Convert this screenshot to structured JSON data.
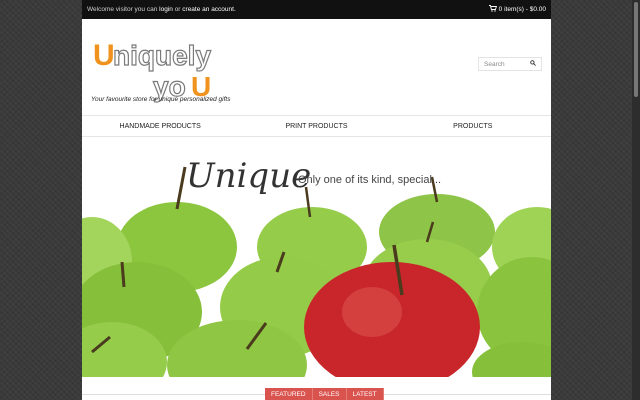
{
  "topbar": {
    "welcome_prefix": "Welcome visitor you can",
    "login": "login",
    "or": "or",
    "create_account": "create an account.",
    "cart_text": "0 item(s) - $0.00"
  },
  "header": {
    "logo_line1": "Uniquely",
    "logo_line2": "you",
    "tagline": "Your favourite store for unique personalized gifts",
    "search_placeholder": "Search"
  },
  "nav": {
    "items": [
      "HANDMADE PRODUCTS",
      "PRINT PRODUCTS",
      "PRODUCTS"
    ]
  },
  "hero": {
    "title": "Unique",
    "subtitle": "Only one of its kind, special..."
  },
  "tabs": [
    "FEATURED",
    "SALES",
    "LATEST"
  ],
  "colors": {
    "accent_orange": "#f0931e",
    "tab_red": "#d9534f",
    "topbar_bg": "#111111"
  }
}
